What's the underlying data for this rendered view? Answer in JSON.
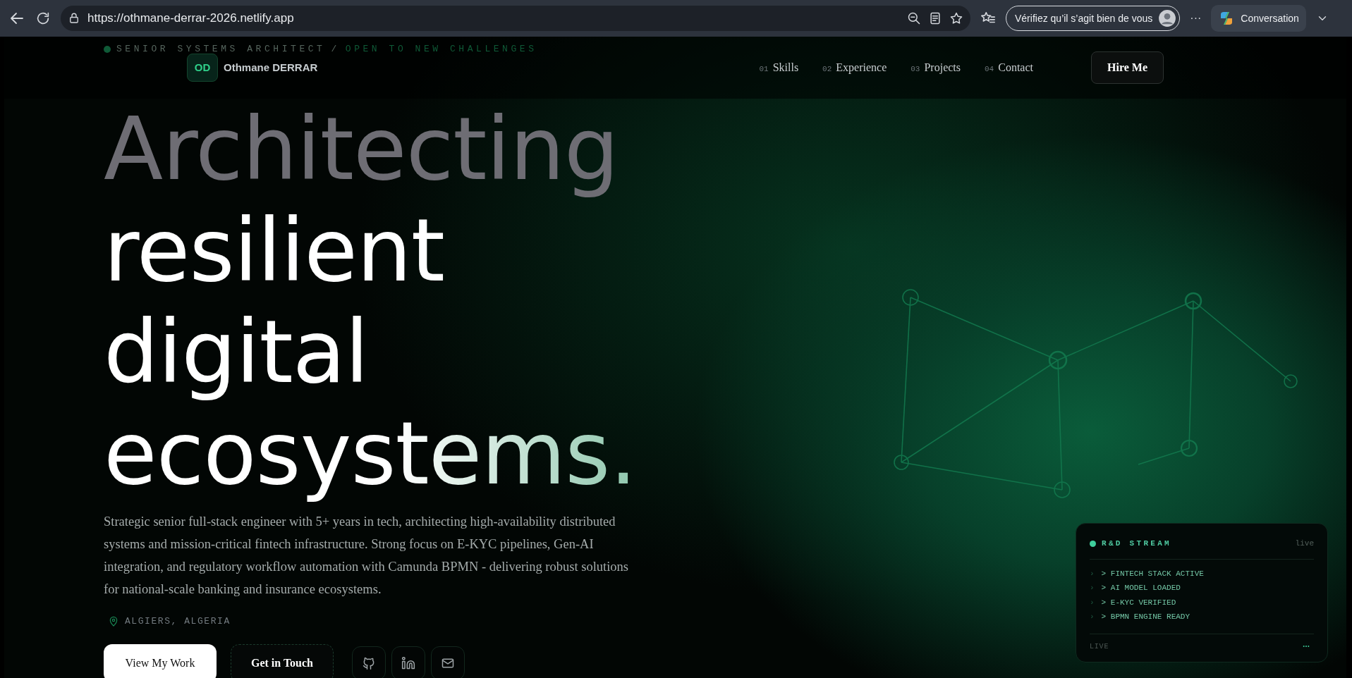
{
  "browser": {
    "url": "https://othmane-derrar-2026.netlify.app",
    "profile_button": "Vérifiez qu’il s’agit bien de vous",
    "more": "···",
    "copilot_button": "Conversation"
  },
  "tagline": {
    "role": "SENIOR SYSTEMS ARCHITECT",
    "separator": "/",
    "status": "OPEN TO NEW CHALLENGES"
  },
  "brand": {
    "monogram": "OD",
    "name": "Othmane DERRAR"
  },
  "nav": [
    {
      "number": "01",
      "label": "Skills"
    },
    {
      "number": "02",
      "label": "Experience"
    },
    {
      "number": "03",
      "label": "Projects"
    },
    {
      "number": "04",
      "label": "Contact"
    }
  ],
  "cta": "Hire Me",
  "hero": {
    "lines": [
      {
        "text": "Architecting",
        "kind": "muted"
      },
      {
        "text": "resilient",
        "kind": "bright"
      },
      {
        "text": "digital",
        "kind": "bright"
      },
      {
        "text": "ecosystems.",
        "kind": "gradient"
      }
    ],
    "intro": "Strategic senior full-stack engineer with 5+ years in tech, architecting high-availability distributed systems and mission-critical fintech infrastructure. Strong focus on E-KYC pipelines, Gen-AI integration, and regulatory workflow automation with Camunda BPMN - delivering robust solutions for national-scale banking and insurance ecosystems.",
    "location": "ALGIERS, ALGERIA",
    "buttons": [
      {
        "label": "View My Work",
        "kind": "primary"
      },
      {
        "label": "Get in Touch",
        "kind": "outline"
      }
    ],
    "socials": [
      {
        "kind": "github"
      },
      {
        "kind": "linkedin"
      },
      {
        "kind": "email"
      }
    ]
  },
  "stream": {
    "title": "R&D STREAM",
    "badge": "live",
    "items": [
      {
        "marker": "›",
        "text": "> FINTECH STACK ACTIVE"
      },
      {
        "marker": "›",
        "text": "> AI MODEL LOADED"
      },
      {
        "marker": "›",
        "text": "> E-KYC VERIFIED"
      },
      {
        "marker": "›",
        "text": "> BPMN ENGINE READY"
      }
    ],
    "footer": "LIVE"
  }
}
